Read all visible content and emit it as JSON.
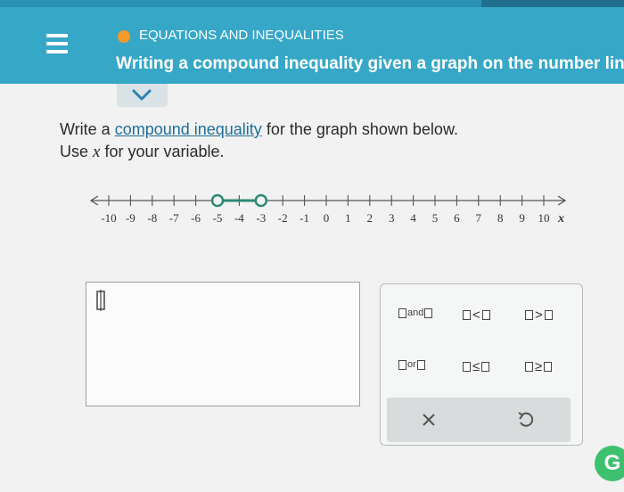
{
  "header": {
    "topic": "EQUATIONS AND INEQUALITIES",
    "title": "Writing a compound inequality given a graph on the number line",
    "accent": "#37a7c8",
    "dot_color": "#f39a28"
  },
  "problem": {
    "line1_pre": "Write a ",
    "link": "compound inequality",
    "line1_post": " for the graph shown below.",
    "line2_pre": "Use ",
    "variable": "x",
    "line2_post": " for your variable."
  },
  "number_line": {
    "ticks": [
      "-10",
      "-9",
      "-8",
      "-7",
      "-6",
      "-5",
      "-4",
      "-3",
      "-2",
      "-1",
      "0",
      "1",
      "2",
      "3",
      "4",
      "5",
      "6",
      "7",
      "8",
      "9",
      "10"
    ],
    "axis_label": "x",
    "open_circles": [
      -5,
      -3
    ]
  },
  "answer": {
    "value": ""
  },
  "keypad": {
    "keys": [
      {
        "name": "and-key",
        "left": "",
        "word": "and",
        "sym": ""
      },
      {
        "name": "less-than-key",
        "word": "",
        "sym": "<"
      },
      {
        "name": "greater-than-key",
        "word": "",
        "sym": ">"
      },
      {
        "name": "or-key",
        "word": "or",
        "sym": ""
      },
      {
        "name": "less-equal-key",
        "word": "",
        "sym": "≤"
      },
      {
        "name": "greater-equal-key",
        "word": "",
        "sym": "≥"
      }
    ],
    "clear_icon": "x-icon",
    "undo_icon": "undo-icon"
  },
  "badge": {
    "letter": "G",
    "color": "#3ec16f"
  }
}
